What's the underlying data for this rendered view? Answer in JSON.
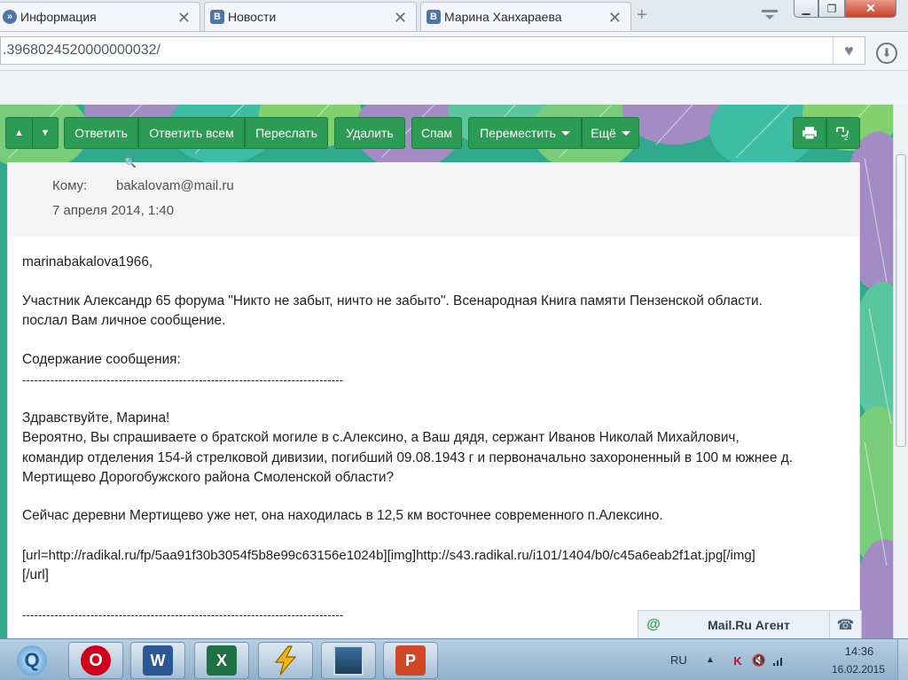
{
  "browser": {
    "tabs": [
      {
        "label": "Информация",
        "icon": "vk"
      },
      {
        "label": "Новости",
        "icon": "vk",
        "favicon": "В"
      },
      {
        "label": "Марина Ханхараева",
        "icon": "vk",
        "favicon": "В"
      }
    ],
    "new_tab": "+",
    "address": ".3968024520000000032/",
    "window_controls": {
      "minimize": "▁",
      "maximize": "❐",
      "close": "✕"
    }
  },
  "toolbar": {
    "up": "▲",
    "down": "▼",
    "reply": "Ответить",
    "reply_all": "Ответить всем",
    "forward": "Переслать",
    "delete": "Удалить",
    "spam": "Спам",
    "move": "Переместить",
    "more": "Ещё",
    "print_icon": "printer-icon",
    "translate_icon": "translate-icon"
  },
  "message": {
    "to_label": "Кому:",
    "to_value": "bakalovam@mail.ru",
    "date": "7 апреля 2014, 1:40",
    "body": [
      "marinabakalova1966,",
      "Участник Александр 65 форума \"Никто не забыт, ничто не забыто\". Всенародная Книга памяти Пензенской области.",
      "послал Вам личное сообщение.",
      "Содержание сообщения:",
      "--------------------------------------------------------------------------------",
      "Здравствуйте, Марина!",
      "Вероятно, Вы спрашиваете о братской могиле в с.Алексино, а Ваш дядя, сержант Иванов Николай Михайлович,",
      "командир отделения 154-й стрелковой дивизии, погибший 09.08.1943 г и первоначально захороненный в 100 м южнее д.",
      "Мертищево Дорогобужского района Смоленской области?",
      "Сейчас деревни Мертищево уже нет, она находилась в 12,5 км восточнее современного п.Алексино.",
      "[url=http://radikal.ru/fp/5aa91f30b3054f5b8e99c63156e1024b][img]http://s43.radikal.ru/i101/1404/b0/c45a6eab2f1at.jpg[/img]",
      "[/url]",
      "--------------------------------------------------------------------------------"
    ]
  },
  "agent": {
    "icon": "@",
    "title": "Mail.Ru Агент",
    "phone_icon": "☎"
  },
  "taskbar": {
    "apps": [
      "quicktime",
      "opera",
      "word",
      "excel",
      "winamp",
      "screen-app",
      "powerpoint"
    ],
    "app_letters": {
      "word": "W",
      "excel": "X",
      "opera": "O",
      "powerpoint": "P"
    },
    "lang": "RU",
    "time": "14:36",
    "date": "16.02.2015"
  },
  "colors": {
    "accent_green": "#2c9b53",
    "tab_bg": "#f3f5f8",
    "taskbar": "#a4c0d8"
  }
}
